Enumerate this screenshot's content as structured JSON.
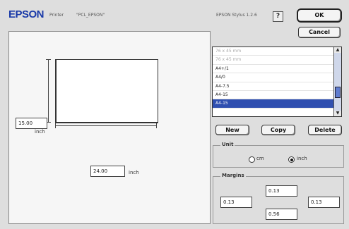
{
  "header": {
    "brand": "EPSON",
    "printer_label": "Printer",
    "printer_name": "\"PCL_EPSON\"",
    "version": "EPSON Stylus 1.2.6"
  },
  "buttons": {
    "help": "?",
    "ok": "OK",
    "cancel": "Cancel",
    "new": "New",
    "copy": "Copy",
    "delete": "Delete"
  },
  "preview": {
    "height_value": "15.00",
    "height_unit": "inch",
    "width_value": "24.00",
    "width_unit": "inch"
  },
  "paper_list": {
    "rows": [
      {
        "label": "76 x 45 mm",
        "state": "dim"
      },
      {
        "label": "76 x 45 mm",
        "state": "dim"
      },
      {
        "label": "A4+/1",
        "state": "normal"
      },
      {
        "label": "A4/0",
        "state": "normal"
      },
      {
        "label": "A4-7.5",
        "state": "normal"
      },
      {
        "label": "A4-15",
        "state": "normal"
      },
      {
        "label": "A4-15",
        "state": "selected"
      }
    ]
  },
  "units": {
    "title": "Unit",
    "cm_label": "cm",
    "inch_label": "inch",
    "selected": "inch"
  },
  "margins": {
    "title": "Margins",
    "top": "0.13",
    "left": "0.13",
    "right": "0.13",
    "bottom": "0.56"
  }
}
